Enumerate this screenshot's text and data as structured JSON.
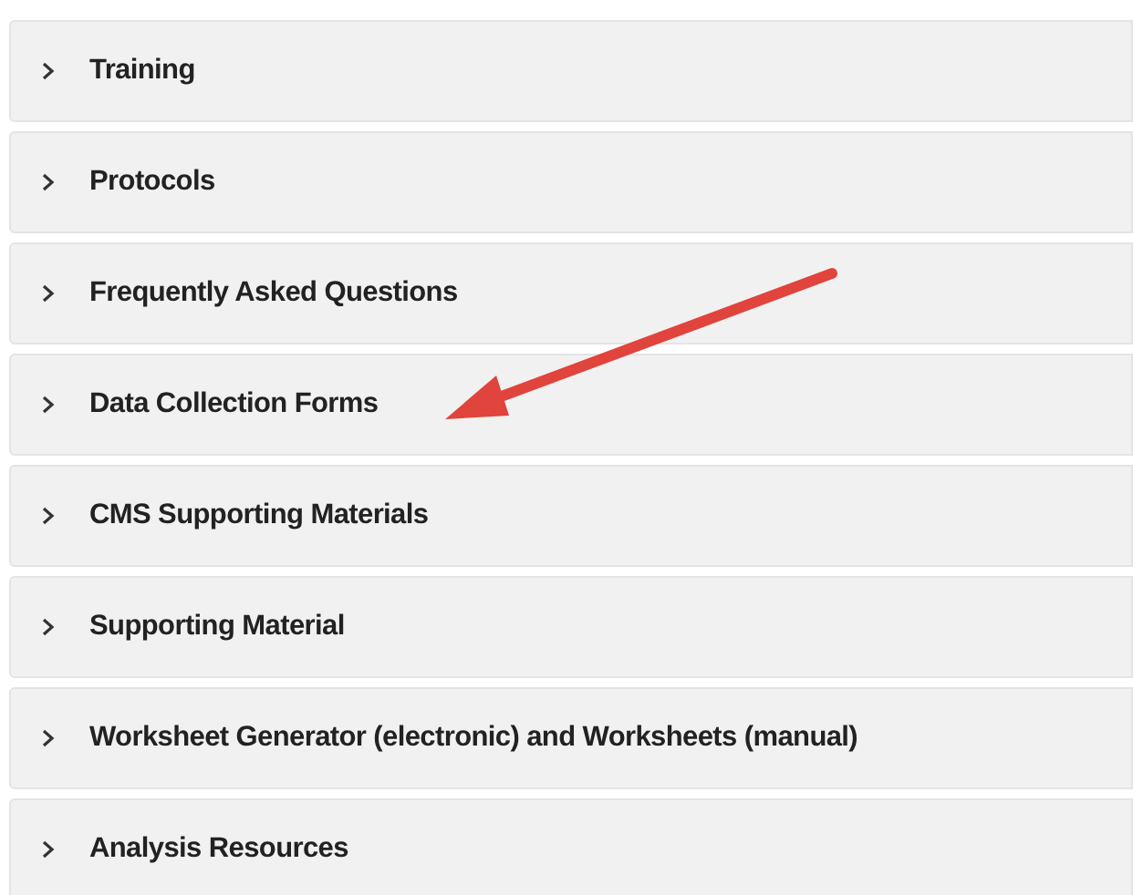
{
  "sections": [
    {
      "title": "Training",
      "expanded": false
    },
    {
      "title": "Protocols",
      "expanded": false
    },
    {
      "title": "Frequently Asked Questions",
      "expanded": false
    },
    {
      "title": "Data Collection Forms",
      "expanded": false
    },
    {
      "title": "CMS Supporting Materials",
      "expanded": false
    },
    {
      "title": "Supporting Material",
      "expanded": false
    },
    {
      "title": "Worksheet Generator (electronic) and Worksheets (manual)",
      "expanded": false
    },
    {
      "title": "Analysis Resources",
      "expanded": false
    }
  ]
}
